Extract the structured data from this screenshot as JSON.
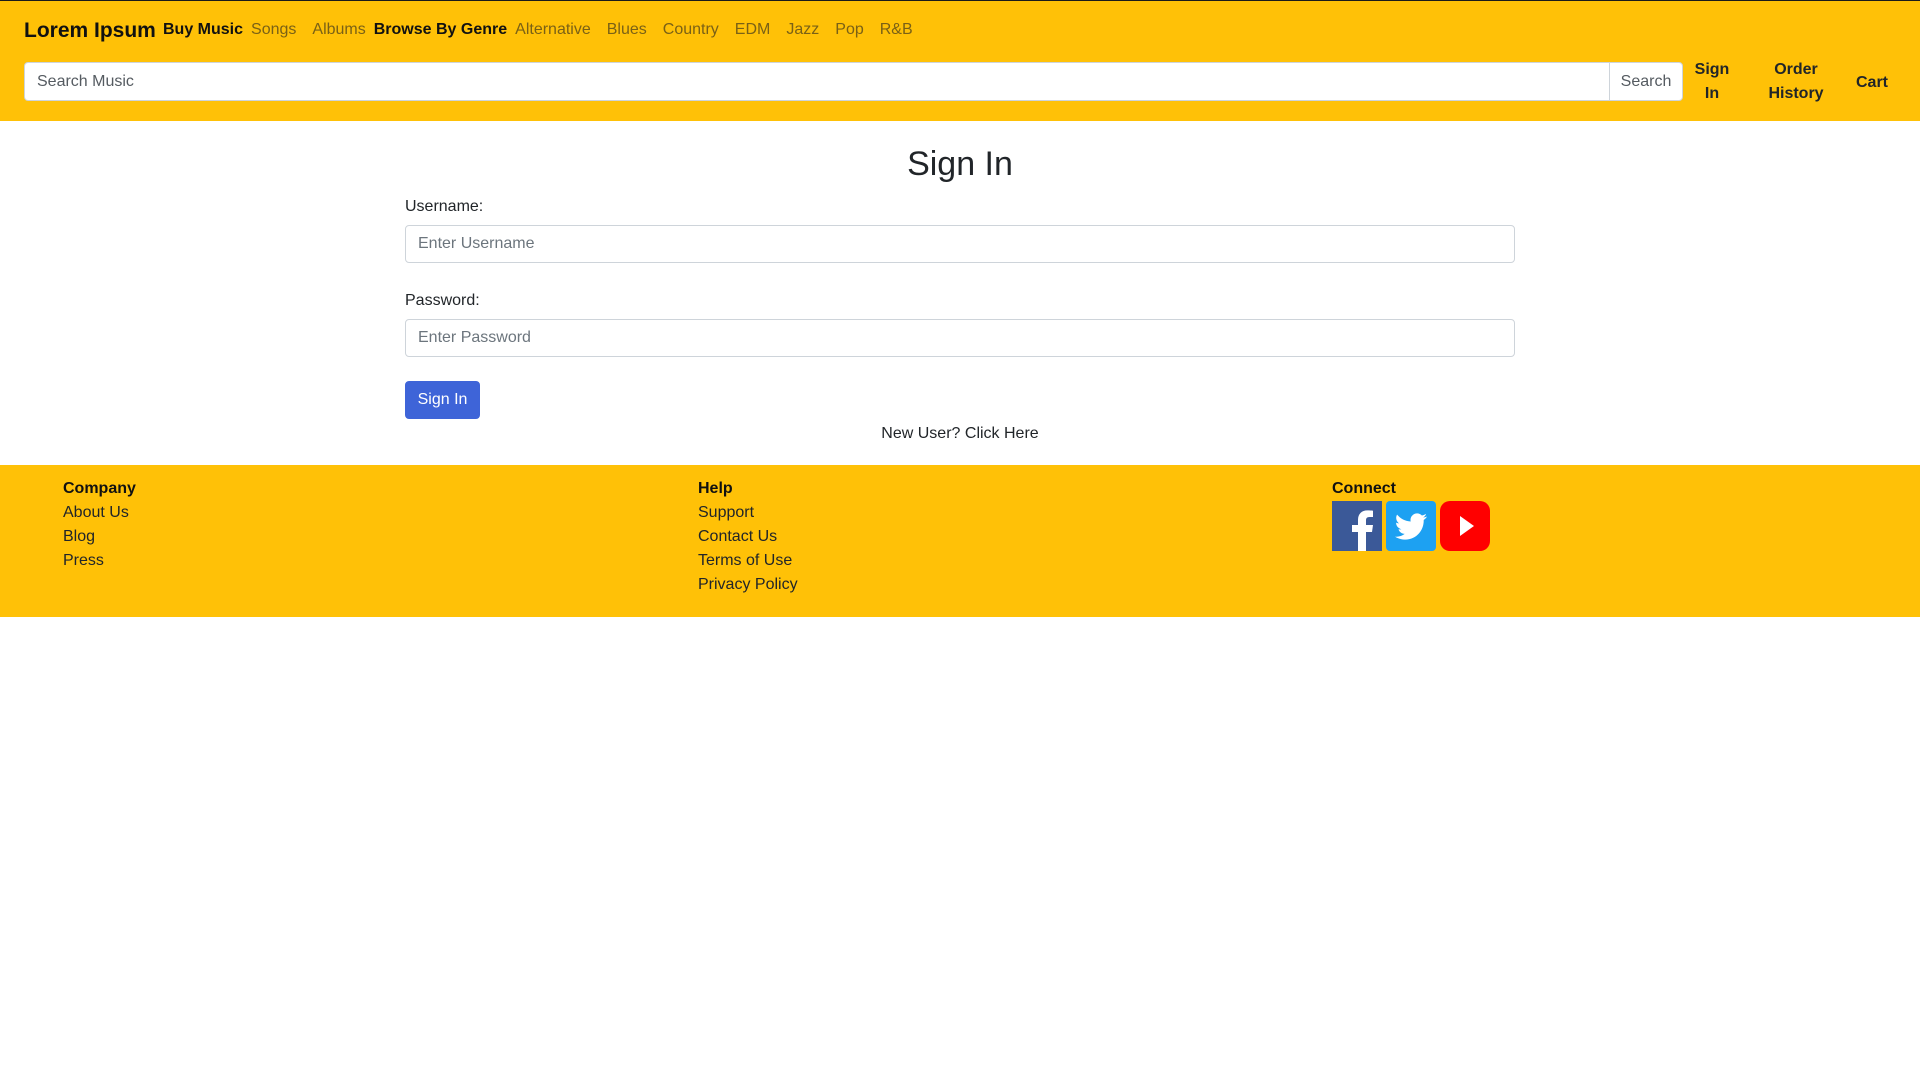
{
  "header": {
    "brand": "Lorem Ipsum",
    "buy_music_label": "Buy Music",
    "buy_links": [
      "Songs",
      "Albums"
    ],
    "browse_label": "Browse By Genre",
    "genres": [
      "Alternative",
      "Blues",
      "Country",
      "EDM",
      "Jazz",
      "Pop",
      "R&B"
    ],
    "search": {
      "placeholder": "Search Music",
      "button_label": "Search"
    },
    "sign_in_line1": "Sign",
    "sign_in_line2": "In",
    "order_history_line1": "Order",
    "order_history_line2": "History",
    "cart": "Cart"
  },
  "main": {
    "title": "Sign In",
    "username_label": "Username:",
    "username_placeholder": "Enter Username",
    "password_label": "Password:",
    "password_placeholder": "Enter Password",
    "submit_label": "Sign In",
    "new_user_text": "New User?",
    "new_user_link": "Click Here"
  },
  "footer": {
    "company_heading": "Company",
    "company_links": [
      "About Us",
      "Blog",
      "Press"
    ],
    "help_heading": "Help",
    "help_links": [
      "Support",
      "Contact Us",
      "Terms of Use",
      "Privacy Policy"
    ],
    "connect_heading": "Connect",
    "social_icons": [
      "facebook-icon",
      "twitter-icon",
      "youtube-icon"
    ]
  },
  "colors": {
    "header_bg": "#ffc107",
    "footer_bg": "#ffc107",
    "primary_button": "#3e64d8",
    "facebook": "#3b5998",
    "twitter": "#1da1f2",
    "youtube": "#ff0000"
  }
}
